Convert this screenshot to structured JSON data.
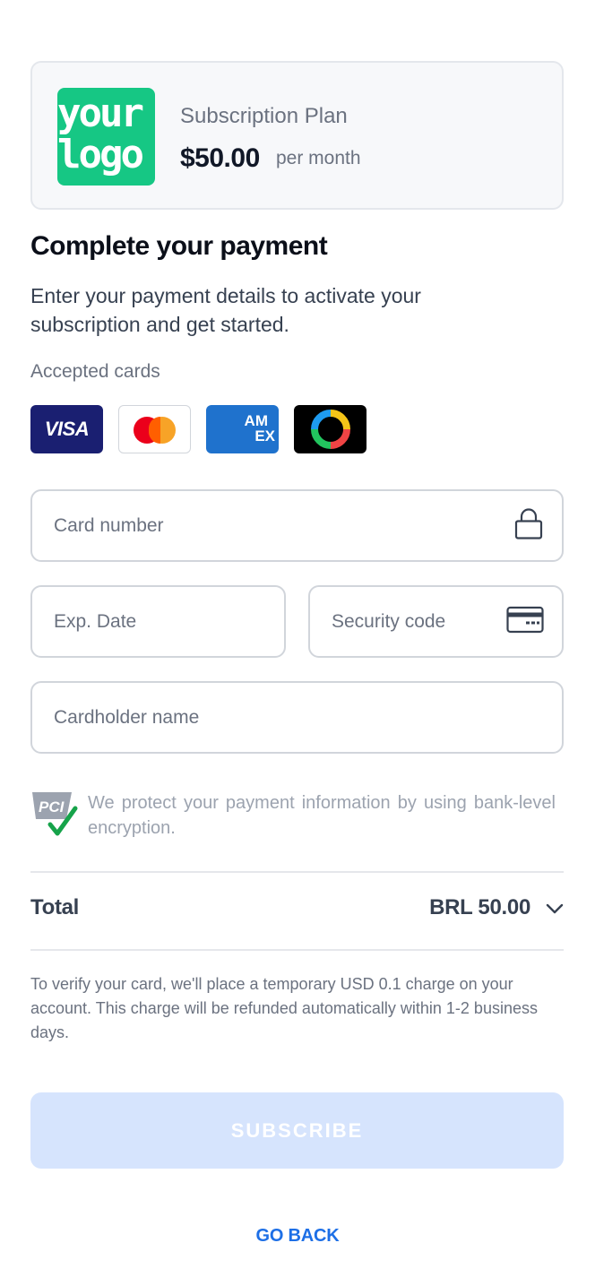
{
  "plan": {
    "logo_line1": "your",
    "logo_line2": "logo",
    "name": "Subscription Plan",
    "price": "$50.00",
    "period": "per month"
  },
  "header": {
    "title": "Complete your payment",
    "subtitle": "Enter your payment details to activate your subscription and get started."
  },
  "accepted_cards": {
    "label": "Accepted cards",
    "cards": [
      {
        "name": "visa",
        "text": "VISA"
      },
      {
        "name": "mastercard",
        "text": ""
      },
      {
        "name": "amex",
        "line1": "AM",
        "line2": "EX"
      },
      {
        "name": "other-card",
        "text": ""
      }
    ]
  },
  "form": {
    "card_number": {
      "placeholder": "Card number",
      "value": ""
    },
    "exp_date": {
      "placeholder": "Exp. Date",
      "value": ""
    },
    "security_code": {
      "placeholder": "Security code",
      "value": ""
    },
    "cardholder_name": {
      "placeholder": "Cardholder name",
      "value": ""
    }
  },
  "security": {
    "badge": "PCI",
    "text": "We protect your payment information by using bank-level encryption."
  },
  "total": {
    "label": "Total",
    "value": "BRL 50.00"
  },
  "notice": "To verify your card, we'll place a temporary USD 0.1 charge on your account. This charge will be refunded automatically within 1-2 business days.",
  "actions": {
    "subscribe_label": "SUBSCRIBE",
    "go_back_label": "GO BACK"
  },
  "colors": {
    "accent": "#1d6fe6",
    "subscribe_disabled": "#d6e4fd",
    "logo_green": "#16c784"
  }
}
